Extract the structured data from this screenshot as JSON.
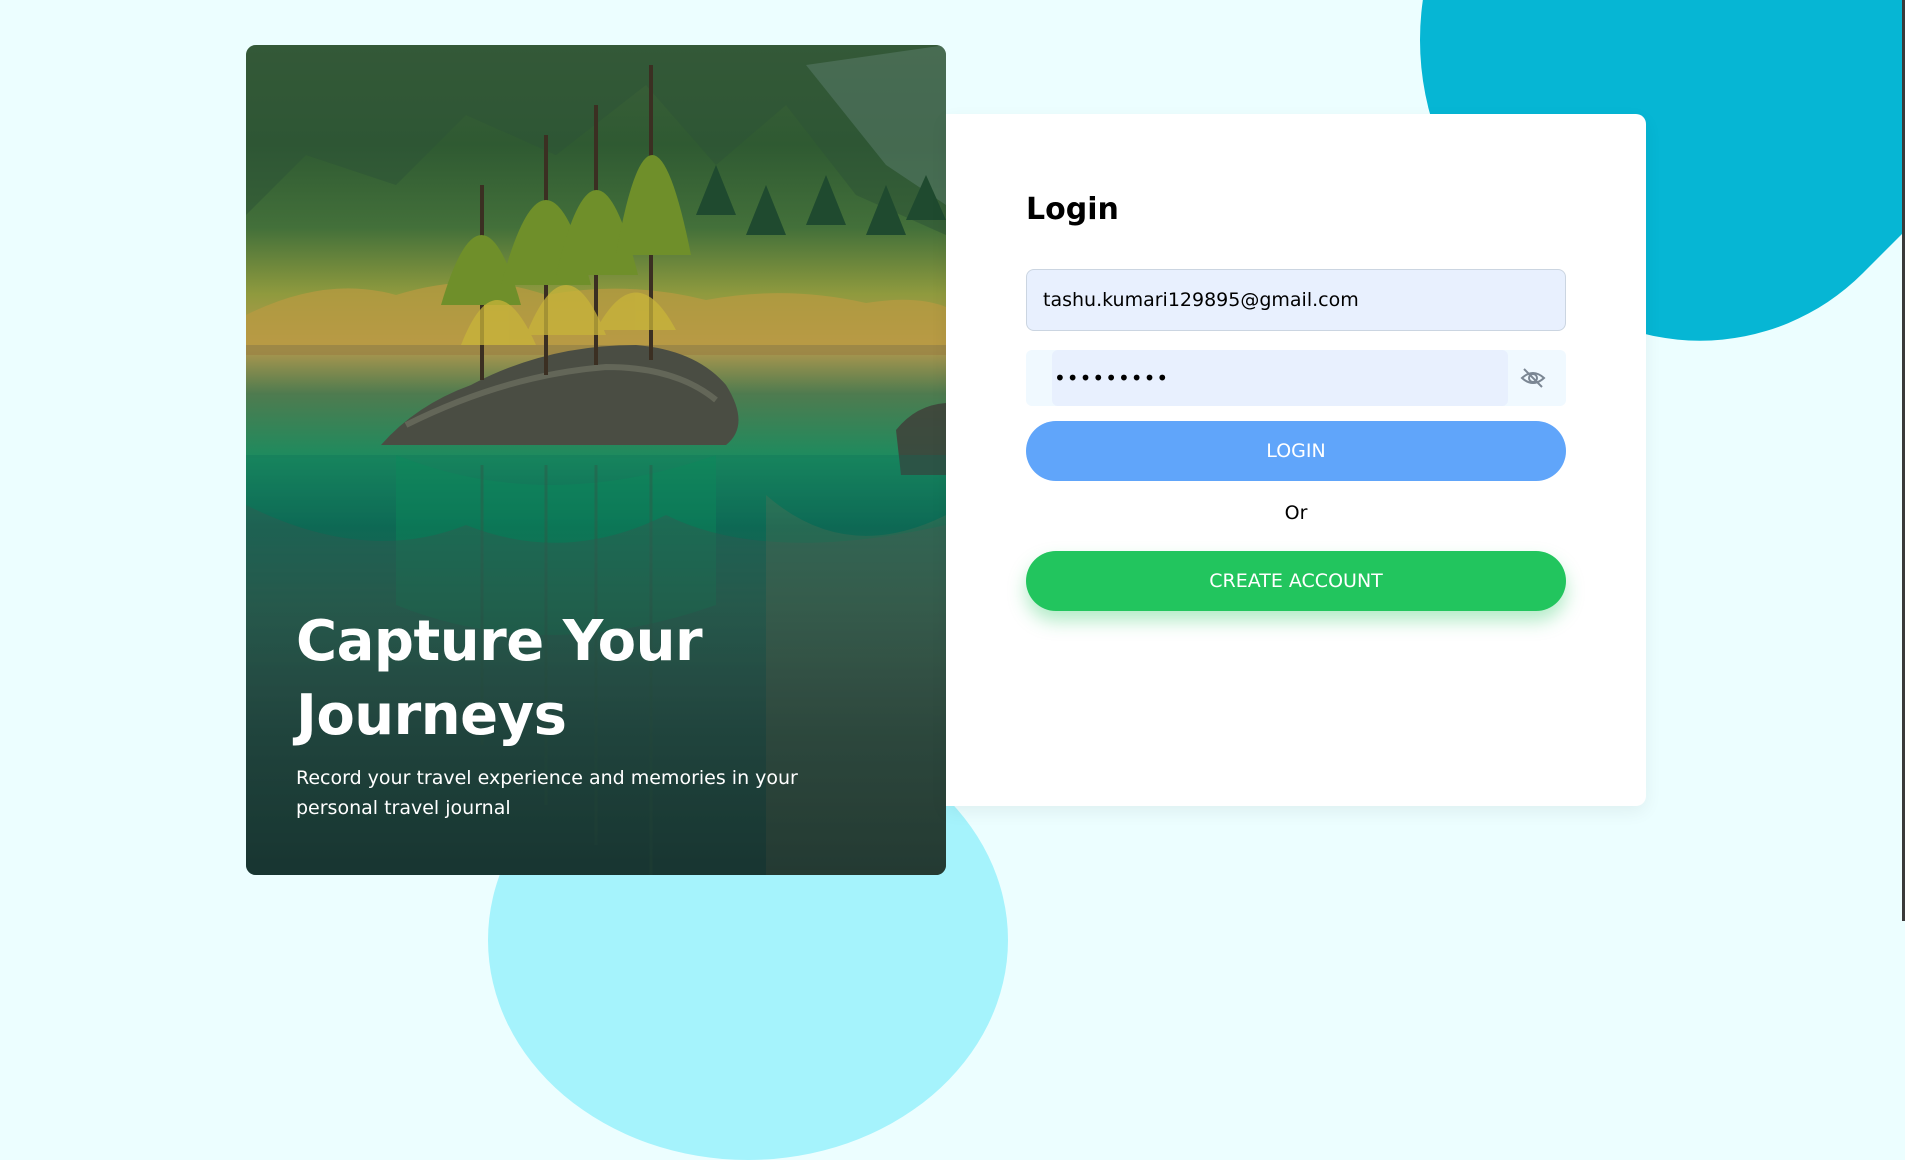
{
  "hero": {
    "title": "Capture Your Journeys",
    "subtitle": "Record your travel experience and memories in your personal travel journal"
  },
  "login": {
    "title": "Login",
    "email_value": "tashu.kumari129895@gmail.com",
    "password_value": "•••••••••",
    "password_toggle_icon": "eye-off-icon",
    "login_label": "LOGIN",
    "or_label": "Or",
    "create_account_label": "CREATE ACCOUNT"
  },
  "colors": {
    "page_background": "#ecfeff",
    "top_blob": "#06b6d4",
    "bottom_blob": "#a5f3fc",
    "input_background": "#e8f0fe",
    "login_button": "#60a5fa",
    "create_account_button": "#22c55e"
  }
}
